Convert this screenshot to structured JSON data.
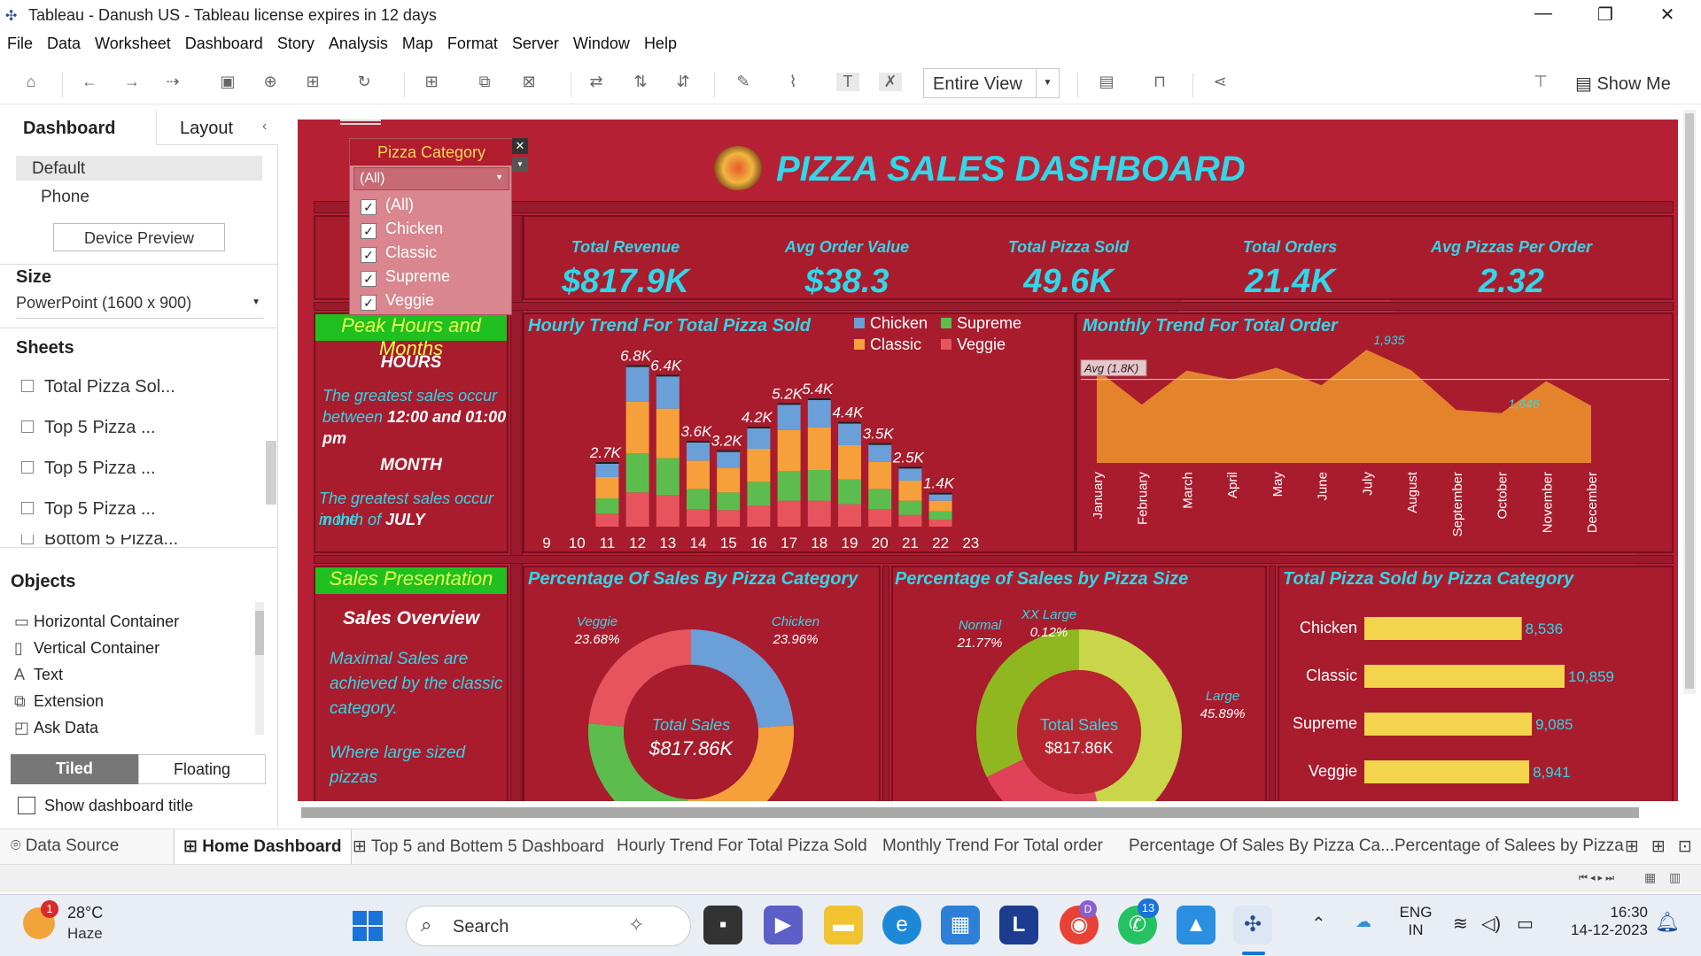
{
  "window": {
    "title": "Tableau - Danush US - Tableau license expires in 12 days"
  },
  "menu": [
    "File",
    "Data",
    "Worksheet",
    "Dashboard",
    "Story",
    "Analysis",
    "Map",
    "Format",
    "Server",
    "Window",
    "Help"
  ],
  "toolbar": {
    "view_mode": "Entire View",
    "show_me": "Show Me"
  },
  "left_pane": {
    "tabs": [
      "Dashboard",
      "Layout"
    ],
    "devices": [
      "Default",
      "Phone"
    ],
    "device_preview": "Device Preview",
    "size_label": "Size",
    "size_value": "PowerPoint (1600 x 900)",
    "sheets_label": "Sheets",
    "sheets": [
      "Total Pizza Sol...",
      "Top 5 Pizza ...",
      "Top 5 Pizza ...",
      "Top 5 Pizza ...",
      "Bottom 5 Pizza..."
    ],
    "objects_label": "Objects",
    "objects": [
      "Horizontal Container",
      "Vertical Container",
      "Text",
      "Extension",
      "Ask Data"
    ],
    "tiled": "Tiled",
    "floating": "Floating",
    "show_title": "Show dashboard title"
  },
  "dashboard": {
    "title": "PIZZA SALES DASHBOARD",
    "filter": {
      "title": "Pizza Category",
      "selected": "(All)",
      "options": [
        "(All)",
        "Chicken",
        "Classic",
        "Supreme",
        "Veggie"
      ]
    },
    "kpis": [
      {
        "label": "Total Revenue",
        "value": "$817.9K"
      },
      {
        "label": "Avg Order Value",
        "value": "$38.3"
      },
      {
        "label": "Total Pizza Sold",
        "value": "49.6K"
      },
      {
        "label": "Total Orders",
        "value": "21.4K"
      },
      {
        "label": "Avg Pizzas Per Order",
        "value": "2.32"
      }
    ],
    "peak": {
      "header": "Peak Hours and Months",
      "hours_h": "HOURS",
      "hours_txt1": "The greatest sales occur",
      "hours_txt2_a": "between ",
      "hours_txt2_b": "12:00  and 01:00 pm",
      "month_h": "MONTH",
      "month_txt1": "The greatest sales occur in the",
      "month_txt2_a": "month of ",
      "month_txt2_b": "JULY"
    },
    "sales_pres": {
      "header": "Sales Presentation",
      "overview": "Sales Overview",
      "txt1": "Maximal Sales are",
      "txt2": "achieved by the classic",
      "txt3": "category.",
      "txt4": "Where large sized pizzas"
    },
    "titles": {
      "hourly": "Hourly Trend  For Total Pizza Sold",
      "monthly": "Monthly Trend For Total Order",
      "pct_category": "Percentage Of Sales By Pizza Category",
      "pct_size": "Percentage of Salees by Pizza Size",
      "total_by_cat": "Total Pizza Sold  by Pizza Category"
    },
    "donut_center": {
      "label": "Total Sales",
      "cat_value": "$817.86K",
      "size_value": "$817.86K"
    },
    "colors": {
      "chicken": "#6a9fd8",
      "classic": "#f5a03a",
      "supreme": "#5cbd4e",
      "veggie": "#e7545e",
      "accent": "#2fd8ea",
      "bar_yellow": "#f3d44c"
    }
  },
  "chart_data": [
    {
      "type": "bar",
      "title": "Hourly Trend  For Total Pizza Sold",
      "categories": [
        "9",
        "10",
        "11",
        "12",
        "13",
        "14",
        "15",
        "16",
        "17",
        "18",
        "19",
        "20",
        "21",
        "22",
        "23"
      ],
      "totals": [
        0,
        0,
        2700,
        6800,
        6400,
        3600,
        3200,
        4200,
        5200,
        5400,
        4400,
        3500,
        2500,
        1400,
        0
      ],
      "total_labels": [
        "",
        "",
        "2.7K",
        "6.8K",
        "6.4K",
        "3.6K",
        "3.2K",
        "4.2K",
        "5.2K",
        "5.4K",
        "4.4K",
        "3.5K",
        "2.5K",
        "1.4K",
        ""
      ],
      "series": [
        {
          "name": "Chicken",
          "values": [
            0,
            0,
            600,
            1500,
            1400,
            800,
            700,
            900,
            1100,
            1200,
            950,
            750,
            550,
            300,
            0
          ]
        },
        {
          "name": "Classic",
          "values": [
            0,
            0,
            900,
            2200,
            2100,
            1200,
            1050,
            1400,
            1750,
            1800,
            1450,
            1150,
            850,
            450,
            0
          ]
        },
        {
          "name": "Supreme",
          "values": [
            0,
            0,
            650,
            1650,
            1550,
            850,
            750,
            1000,
            1250,
            1300,
            1050,
            850,
            600,
            350,
            0
          ]
        },
        {
          "name": "Veggie",
          "values": [
            0,
            0,
            550,
            1450,
            1350,
            750,
            700,
            900,
            1100,
            1100,
            950,
            750,
            500,
            300,
            0
          ]
        }
      ],
      "ylim": [
        0,
        7500
      ]
    },
    {
      "type": "area",
      "title": "Monthly Trend For Total Order",
      "categories": [
        "January",
        "February",
        "March",
        "April",
        "May",
        "June",
        "July",
        "August",
        "September",
        "October",
        "November",
        "December"
      ],
      "values": [
        1845,
        1685,
        1840,
        1799,
        1853,
        1773,
        1935,
        1841,
        1661,
        1646,
        1792,
        1680
      ],
      "point_labels": {
        "6": "1,935",
        "9": "1,646"
      },
      "reference_line": {
        "label": "Avg (1.8K)",
        "value": 1800
      },
      "ylim": [
        0,
        2000
      ]
    },
    {
      "type": "pie",
      "title": "Percentage Of Sales By Pizza Category",
      "labels": [
        "Chicken",
        "Classic",
        "Supreme",
        "Veggie"
      ],
      "values": [
        23.96,
        26.91,
        25.46,
        23.68
      ],
      "shown_labels": {
        "Chicken": "23.96%",
        "Veggie": "23.68%"
      }
    },
    {
      "type": "pie",
      "title": "Percentage of Salees by Pizza Size",
      "labels": [
        "Large",
        "XX Large",
        "Normal",
        "Other"
      ],
      "values": [
        45.89,
        0.12,
        21.77,
        32.22
      ],
      "shown_labels": {
        "Large": "45.89%",
        "XX Large": "0.12%",
        "Normal": "21.77%"
      }
    },
    {
      "type": "bar",
      "title": "Total Pizza Sold  by Pizza Category",
      "categories": [
        "Chicken",
        "Classic",
        "Supreme",
        "Veggie"
      ],
      "values": [
        8536,
        10859,
        9085,
        8941
      ],
      "value_labels": [
        "8,536",
        "10,859",
        "9,085",
        "8,941"
      ],
      "xlim": [
        0,
        11500
      ]
    }
  ],
  "bottom_tabs": [
    "Data Source",
    "Home  Dashboard",
    "Top 5 and Bottem 5 Dashboard",
    "Hourly Trend  For Total Pizza Sold",
    "Monthly Trend For Total order",
    "Percentage Of Sales By Pizza Ca...",
    "Percentage of Salees by Pizza"
  ],
  "taskbar": {
    "weather_temp": "28°C",
    "weather_desc": "Haze",
    "weather_badge": "1",
    "search": "Search",
    "lang1": "ENG",
    "lang2": "IN",
    "time": "16:30",
    "date": "14-12-2023",
    "whatsapp_badge": "13",
    "chrome_badge": "D"
  }
}
